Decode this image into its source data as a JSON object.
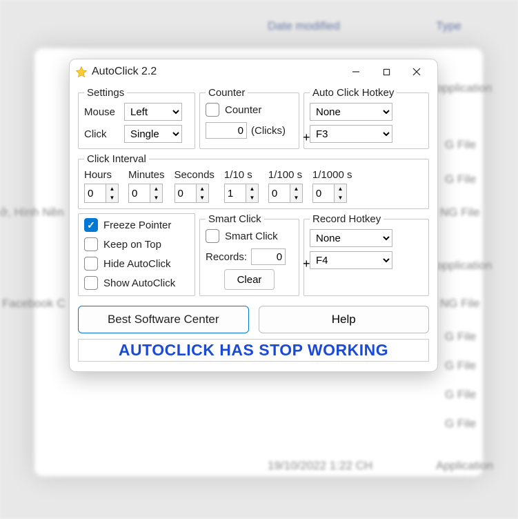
{
  "bg": {
    "col_date": "Date modified",
    "col_type": "Type",
    "type_app": "Application",
    "type_png": "PNG File",
    "row1": "ở, Hình Nền",
    "row2": "Facebook C",
    "date1": "19/10/2022 1:22 CH",
    "gfile": "G File",
    "ngfile": "NG File",
    "opp": "opplication"
  },
  "window": {
    "title": "AutoClick 2.2"
  },
  "settings": {
    "legend": "Settings",
    "mouse_label": "Mouse",
    "mouse_value": "Left",
    "click_label": "Click",
    "click_value": "Single"
  },
  "counter": {
    "legend": "Counter",
    "checkbox_label": "Counter",
    "value": "0",
    "unit": "(Clicks)"
  },
  "hotkey": {
    "legend": "Auto Click Hotkey",
    "mod": "None",
    "key": "F3"
  },
  "interval": {
    "legend": "Click Interval",
    "hours_label": "Hours",
    "minutes_label": "Minutes",
    "seconds_label": "Seconds",
    "tenth_label": "1/10 s",
    "hundredth_label": "1/100 s",
    "thousandth_label": "1/1000 s",
    "hours": "0",
    "minutes": "0",
    "seconds": "0",
    "tenth": "1",
    "hundredth": "0",
    "thousandth": "0"
  },
  "options": {
    "freeze": "Freeze Pointer",
    "keep_top": "Keep on Top",
    "hide": "Hide AutoClick",
    "show": "Show AutoClick"
  },
  "smart": {
    "legend": "Smart Click",
    "checkbox_label": "Smart Click",
    "records_label": "Records:",
    "records_value": "0",
    "clear": "Clear"
  },
  "record": {
    "legend": "Record Hotkey",
    "mod": "None",
    "key": "F4"
  },
  "buttons": {
    "best": "Best Software Center",
    "help": "Help"
  },
  "banner": "AUTOCLICK HAS STOP WORKING"
}
